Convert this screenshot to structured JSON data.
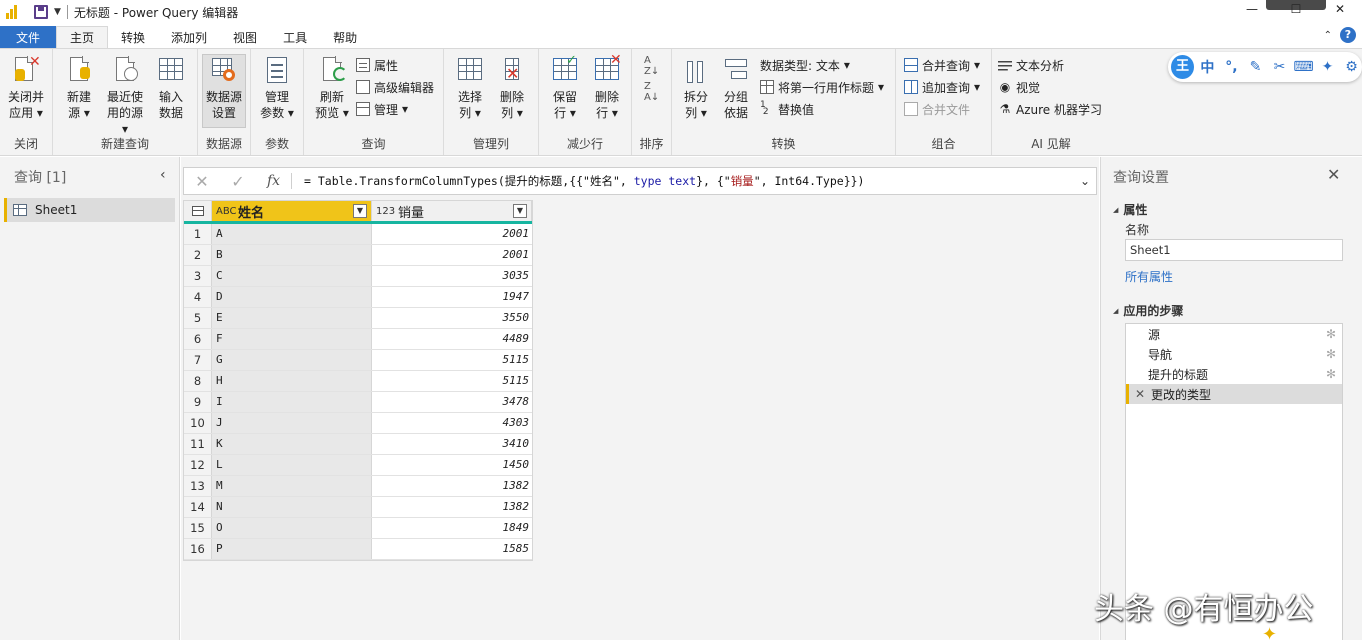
{
  "window": {
    "title": "无标题 - Power Query 编辑器"
  },
  "tabs": {
    "file": "文件",
    "items": [
      "主页",
      "转换",
      "添加列",
      "视图",
      "工具",
      "帮助"
    ],
    "active": "主页"
  },
  "ribbon": {
    "close": {
      "label1": "关闭并",
      "label2": "应用",
      "group": "关闭"
    },
    "new_query": {
      "new_source_1": "新建",
      "new_source_2": "源",
      "recent_1": "最近使",
      "recent_2": "用的源",
      "enter_1": "输入",
      "enter_2": "数据",
      "group": "新建查询"
    },
    "datasource": {
      "label1": "数据源",
      "label2": "设置",
      "group": "数据源"
    },
    "params": {
      "label1": "管理",
      "label2": "参数",
      "group": "参数"
    },
    "query": {
      "refresh_1": "刷新",
      "refresh_2": "预览",
      "properties": "属性",
      "advanced_editor": "高级编辑器",
      "manage": "管理",
      "group": "查询"
    },
    "manage_cols": {
      "choose_1": "选择",
      "choose_2": "列",
      "remove_1": "删除",
      "remove_2": "列",
      "group": "管理列"
    },
    "reduce_rows": {
      "keep_1": "保留",
      "keep_2": "行",
      "remove_1": "删除",
      "remove_2": "行",
      "group": "减少行"
    },
    "sort": {
      "group": "排序"
    },
    "transform": {
      "split_1": "拆分",
      "split_2": "列",
      "group_1": "分组",
      "group_2": "依据",
      "data_type": "数据类型: 文本",
      "first_row_header": "将第一行用作标题",
      "replace_values": "替换值",
      "group": "转换"
    },
    "combine": {
      "merge_queries": "合并查询",
      "append_queries": "追加查询",
      "combine_files": "合并文件",
      "group": "组合"
    },
    "ai": {
      "text_analytics": "文本分析",
      "vision": "视觉",
      "azure_ml": "Azure 机器学习",
      "group": "AI 见解"
    }
  },
  "queries_pane": {
    "title": "查询 [1]",
    "items": [
      "Sheet1"
    ]
  },
  "formula_bar": {
    "p1": "= Table.TransformColumnTypes(提升的标题,{{\"姓名\", ",
    "kw1": "type text",
    "p2": "}, {\"",
    "s1": "销量",
    "p3": "\", Int64.Type}})"
  },
  "table": {
    "columns": [
      {
        "type_icon": "ABC",
        "name": "姓名"
      },
      {
        "type_icon": "123",
        "name": "销量"
      }
    ],
    "rows": [
      {
        "n": "1",
        "name": "A",
        "sales": "2001"
      },
      {
        "n": "2",
        "name": "B",
        "sales": "2001"
      },
      {
        "n": "3",
        "name": "C",
        "sales": "3035"
      },
      {
        "n": "4",
        "name": "D",
        "sales": "1947"
      },
      {
        "n": "5",
        "name": "E",
        "sales": "3550"
      },
      {
        "n": "6",
        "name": "F",
        "sales": "4489"
      },
      {
        "n": "7",
        "name": "G",
        "sales": "5115"
      },
      {
        "n": "8",
        "name": "H",
        "sales": "5115"
      },
      {
        "n": "9",
        "name": "I",
        "sales": "3478"
      },
      {
        "n": "10",
        "name": "J",
        "sales": "4303"
      },
      {
        "n": "11",
        "name": "K",
        "sales": "3410"
      },
      {
        "n": "12",
        "name": "L",
        "sales": "1450"
      },
      {
        "n": "13",
        "name": "M",
        "sales": "1382"
      },
      {
        "n": "14",
        "name": "N",
        "sales": "1382"
      },
      {
        "n": "15",
        "name": "O",
        "sales": "1849"
      },
      {
        "n": "16",
        "name": "P",
        "sales": "1585"
      }
    ]
  },
  "settings_pane": {
    "title": "查询设置",
    "properties_header": "属性",
    "name_label": "名称",
    "name_value": "Sheet1",
    "all_properties": "所有属性",
    "steps_header": "应用的步骤",
    "steps": [
      "源",
      "导航",
      "提升的标题",
      "更改的类型"
    ],
    "active_step": "更改的类型"
  },
  "ime": {
    "logo": "王",
    "mode": "中"
  },
  "watermark": "头条 @有恒办公",
  "colors": {
    "accent": "#2e71c7",
    "selected_column": "#f0c419",
    "column_quality": "#16b5a0",
    "active_marker": "#e8b100"
  }
}
